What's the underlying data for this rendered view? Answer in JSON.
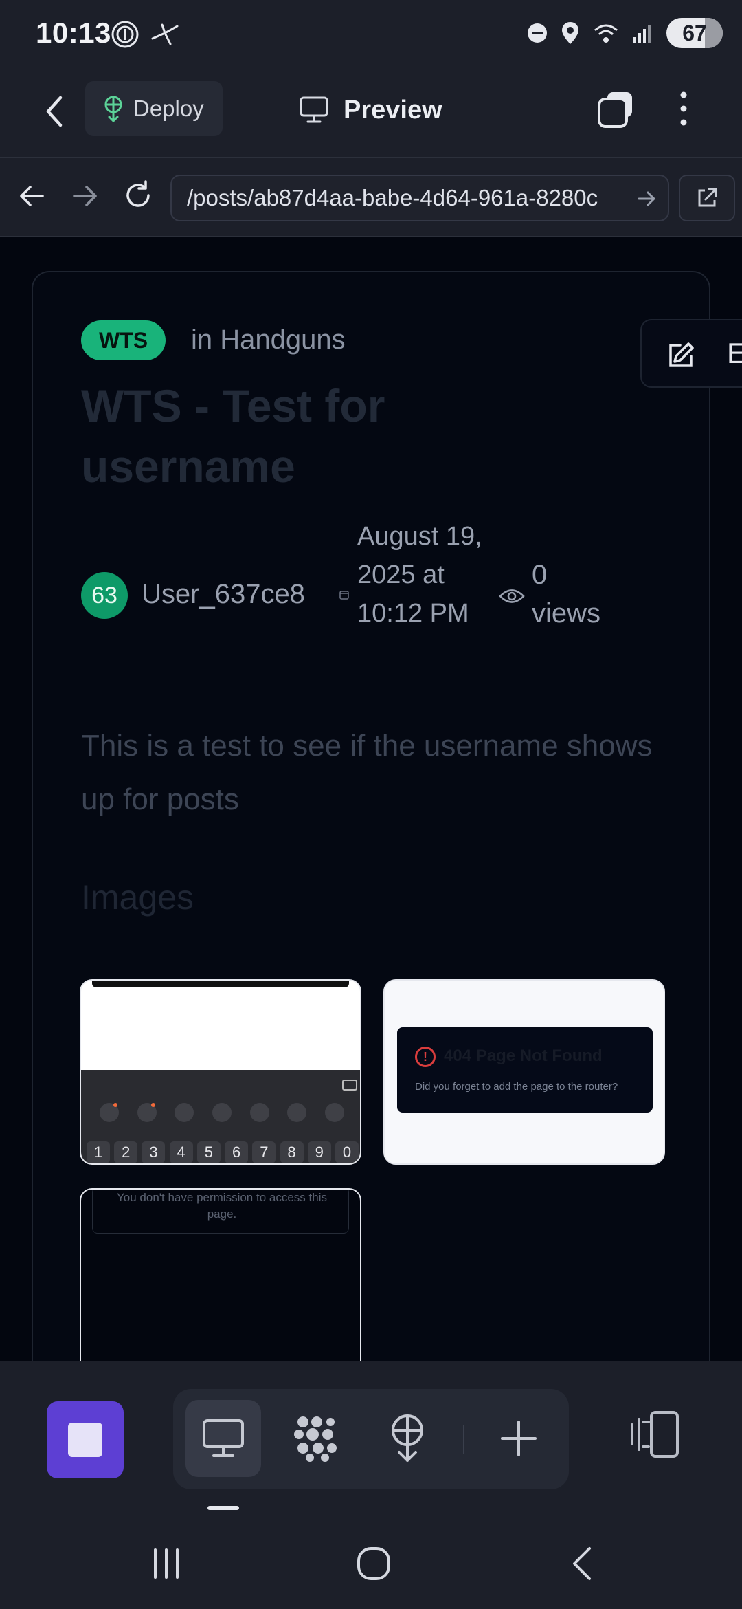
{
  "status_bar": {
    "time": "10:13",
    "battery": "67"
  },
  "header": {
    "deploy_label": "Deploy",
    "preview_label": "Preview"
  },
  "browser": {
    "url": "/posts/ab87d4aa-babe-4d64-961a-8280c"
  },
  "post": {
    "badge": "WTS",
    "category": "in Handguns",
    "title": "WTS - Test for username",
    "avatar_initials": "63",
    "username": "User_637ce8",
    "date": "August 19, 2025 at 10:12 PM",
    "views": "0 views",
    "body": "This is a test to see if the username shows up for posts",
    "images_heading": "Images",
    "floating_edit_letter": "E"
  },
  "thumbnails": {
    "keyboard_keys": [
      "1",
      "2",
      "3",
      "4",
      "5",
      "6",
      "7",
      "8",
      "9",
      "0"
    ],
    "not_found_title": "404 Page Not Found",
    "not_found_sub": "Did you forget to add the page to the router?",
    "permission_text": "You don't have permission to access this page.",
    "error_glyph": "!"
  },
  "colors": {
    "accent_purple": "#5d3fd3",
    "badge_green": "#19b37a",
    "avatar_green": "#0e9a68",
    "error_red": "#d93d3d"
  },
  "icons": {
    "toolbar": [
      "desktop-icon",
      "apps-grid-icon",
      "deploy-icon",
      "plus-icon"
    ],
    "device": "device-toggle-icon"
  }
}
